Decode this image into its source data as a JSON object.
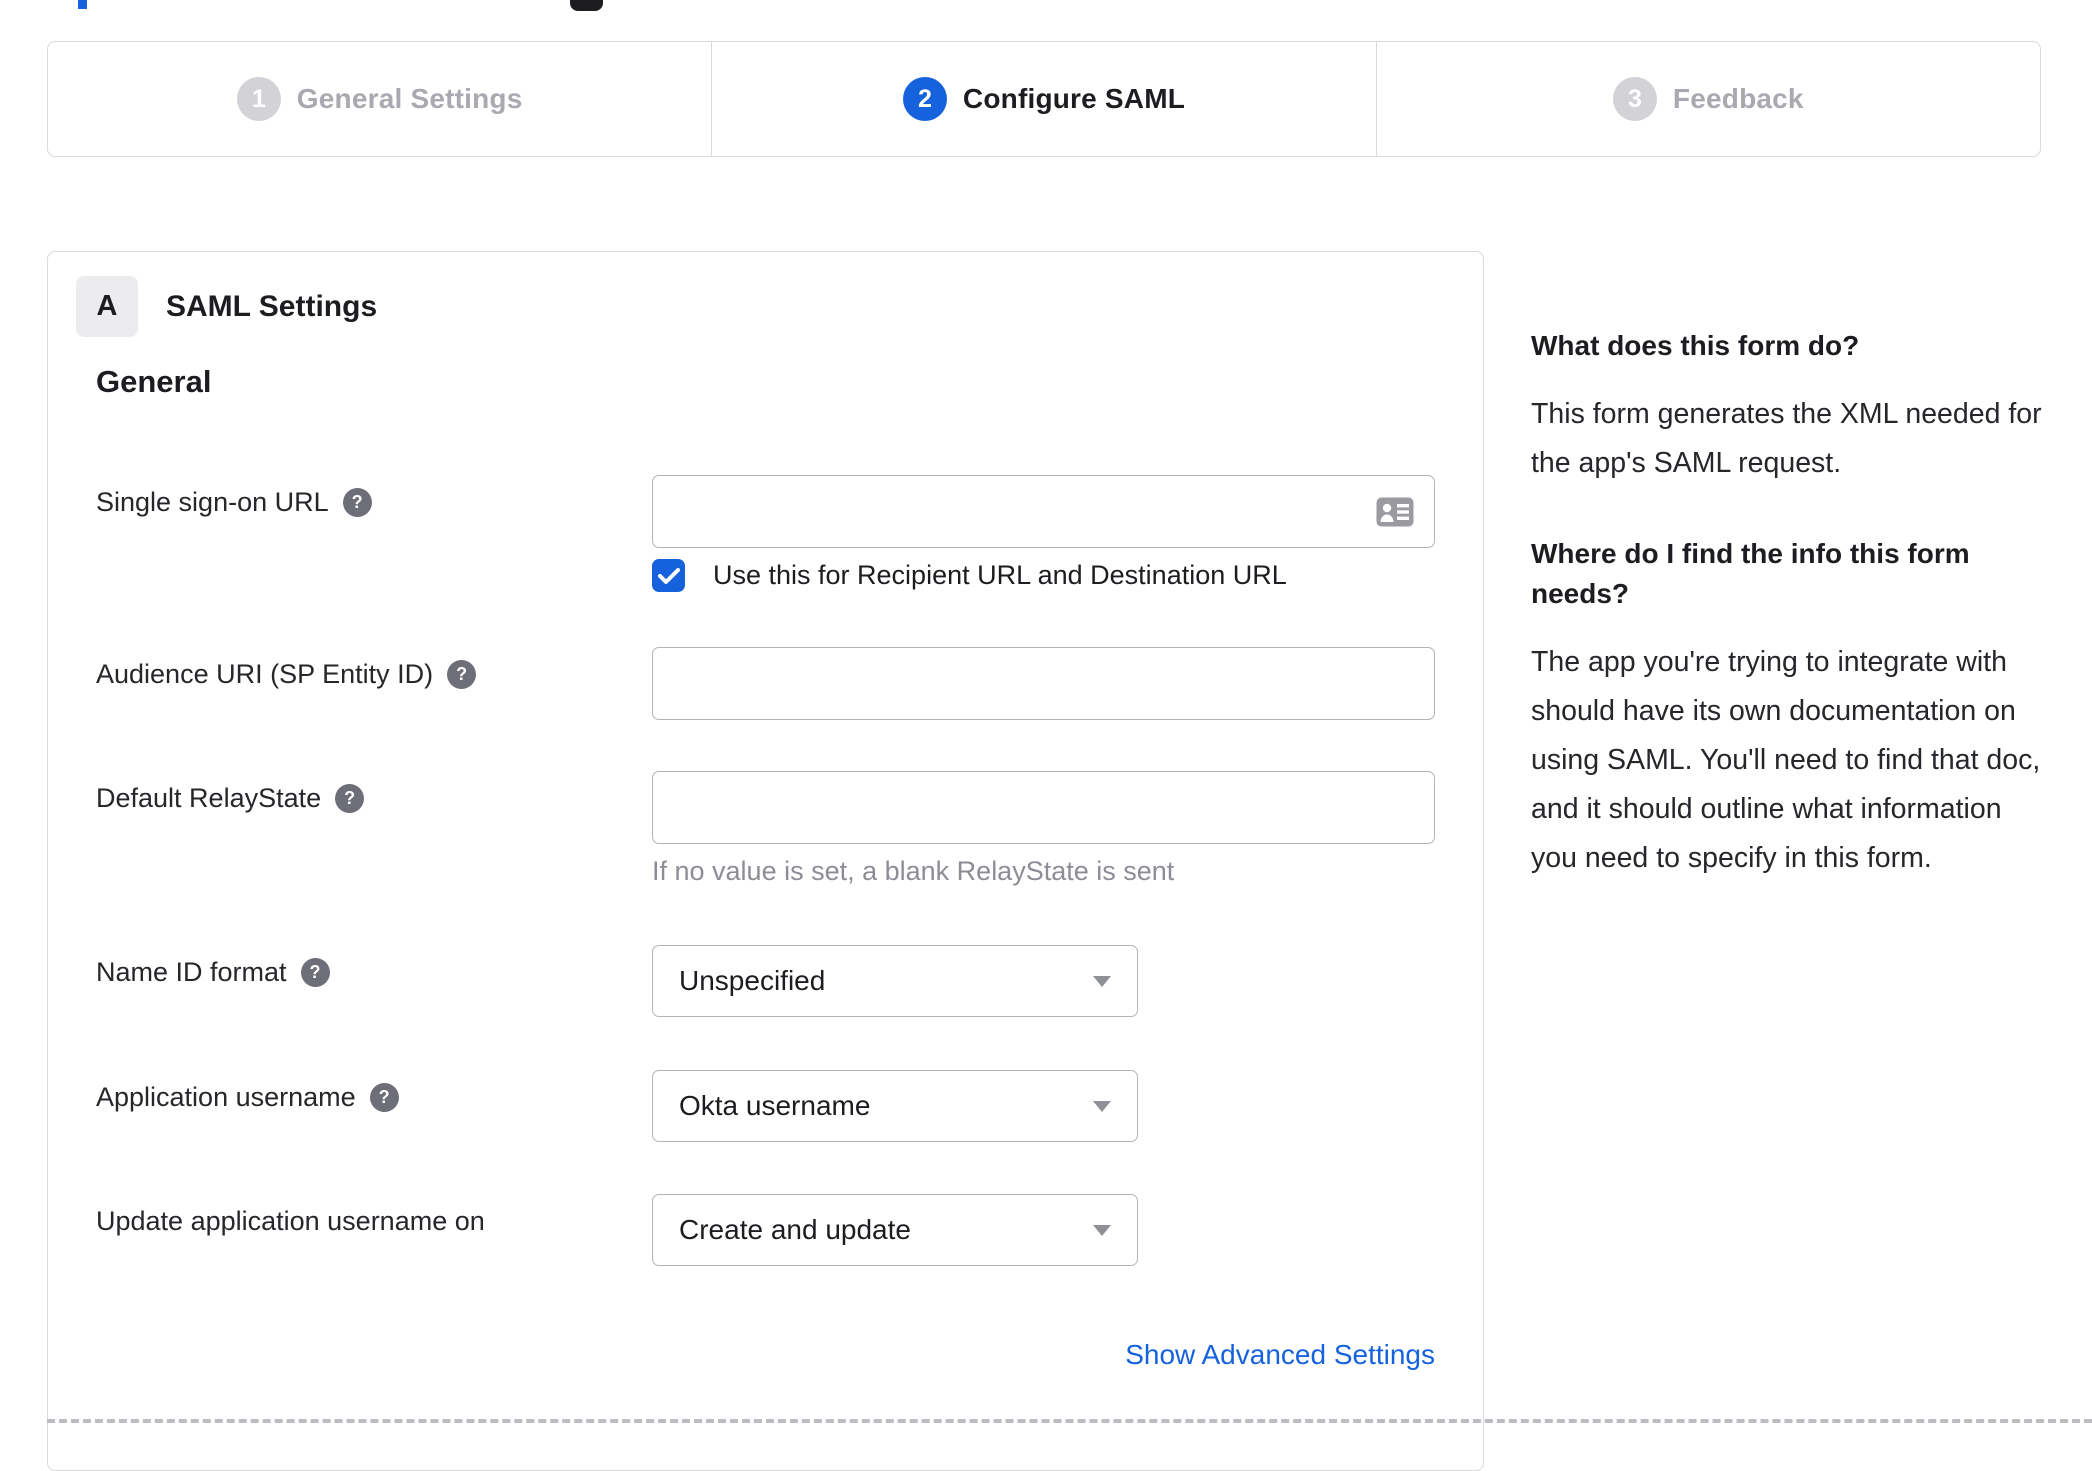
{
  "stepper": {
    "steps": [
      {
        "number": "1",
        "label": "General Settings",
        "state": "inactive"
      },
      {
        "number": "2",
        "label": "Configure SAML",
        "state": "active"
      },
      {
        "number": "3",
        "label": "Feedback",
        "state": "inactive"
      }
    ]
  },
  "panel": {
    "badge": "A",
    "title": "SAML Settings",
    "section_heading": "General",
    "fields": {
      "sso_url": {
        "label": "Single sign-on URL",
        "value": "",
        "has_help": true
      },
      "sso_checkbox": {
        "label": "Use this for Recipient URL and Destination URL",
        "checked": true
      },
      "audience_uri": {
        "label": "Audience URI (SP Entity ID)",
        "value": "",
        "has_help": true
      },
      "relay_state": {
        "label": "Default RelayState",
        "value": "",
        "hint": "If no value is set, a blank RelayState is sent",
        "has_help": true
      },
      "name_id_format": {
        "label": "Name ID format",
        "value": "Unspecified",
        "has_help": true
      },
      "app_username": {
        "label": "Application username",
        "value": "Okta username",
        "has_help": true
      },
      "update_app_username": {
        "label": "Update application username on",
        "value": "Create and update"
      }
    },
    "advanced_link": "Show Advanced Settings"
  },
  "sidebar": {
    "blocks": [
      {
        "heading": "What does this form do?",
        "body": "This form generates the XML needed for the app's SAML request."
      },
      {
        "heading": "Where do I find the info this form needs?",
        "body": "The app you're trying to integrate with should have its own documentation on using SAML. You'll need to find that doc, and it should outline what information you need to specify in this form."
      }
    ]
  },
  "icons": {
    "help_glyph": "?",
    "sso_input_icon": "contact-card-icon",
    "select_caret": "caret-down-icon",
    "checkbox_check": "checkmark-icon"
  },
  "colors": {
    "accent_blue": "#1662dd",
    "active_text": "#1d1d21",
    "inactive_gray": "#a9a9b0",
    "panel_border": "#d9d9de",
    "input_border": "#b3b3ba",
    "hint_gray": "#8d8d95",
    "help_icon_gray": "#6e6e78",
    "link_blue": "#1662dd",
    "badge_bg": "#ececee"
  }
}
